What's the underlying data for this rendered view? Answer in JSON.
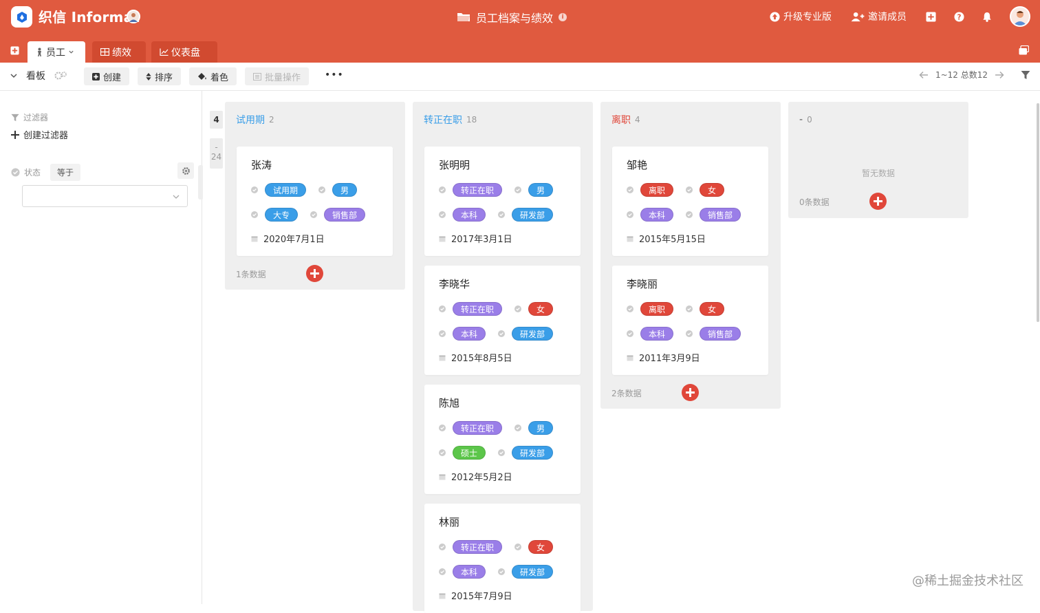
{
  "brand": {
    "name": "织信 Informat"
  },
  "page_title": "员工档案与绩效",
  "top_actions": {
    "upgrade": "升级专业版",
    "invite": "邀请成员"
  },
  "tabs": [
    {
      "label": "员工"
    },
    {
      "label": "绩效"
    },
    {
      "label": "仪表盘"
    }
  ],
  "toolbar": {
    "view": "看板",
    "create": "创建",
    "sort": "排序",
    "color": "着色",
    "batch": "批量操作",
    "more": "•••",
    "pagination": "1~12 总数12"
  },
  "filter": {
    "title": "过滤器",
    "create": "创建过滤器",
    "field": "状态",
    "operator": "等于",
    "value": ""
  },
  "rows": {
    "first": "4",
    "second_dash": "-",
    "second_count": "24"
  },
  "colors": {
    "header": "#e05a3f",
    "trial": "#3a9ee8",
    "regular": "#9a7ee8",
    "left": "#e0473a",
    "green": "#5cc64a"
  },
  "columns": [
    {
      "title": "试用期",
      "count": "2",
      "footer": "1条数据",
      "cards": [
        {
          "name": "张涛",
          "status": "试用期",
          "gender": "男",
          "edu": "大专",
          "dept": "销售部",
          "date": "2020年7月1日"
        }
      ]
    },
    {
      "title": "转正在职",
      "count": "18",
      "cards": [
        {
          "name": "张明明",
          "status": "转正在职",
          "gender": "男",
          "edu": "本科",
          "dept": "研发部",
          "date": "2017年3月1日"
        },
        {
          "name": "李晓华",
          "status": "转正在职",
          "gender": "女",
          "edu": "本科",
          "dept": "研发部",
          "date": "2015年8月5日"
        },
        {
          "name": "陈旭",
          "status": "转正在职",
          "gender": "男",
          "edu": "硕士",
          "dept": "研发部",
          "date": "2012年5月2日"
        },
        {
          "name": "林丽",
          "status": "转正在职",
          "gender": "女",
          "edu": "本科",
          "dept": "研发部",
          "date": "2015年7月9日"
        }
      ]
    },
    {
      "title": "离职",
      "count": "4",
      "footer": "2条数据",
      "cards": [
        {
          "name": "邹艳",
          "status": "离职",
          "gender": "女",
          "edu": "本科",
          "dept": "销售部",
          "date": "2015年5月15日"
        },
        {
          "name": "李晓丽",
          "status": "离职",
          "gender": "女",
          "edu": "本科",
          "dept": "销售部",
          "date": "2011年3月9日"
        }
      ]
    },
    {
      "title": "-",
      "count": "0",
      "empty": "暂无数据",
      "footer": "0条数据"
    }
  ],
  "watermark": "@稀土掘金技术社区"
}
